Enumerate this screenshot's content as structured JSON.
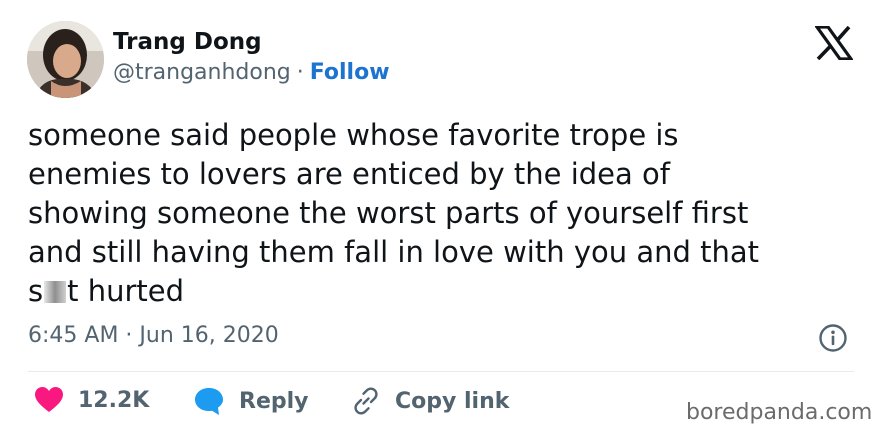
{
  "author": {
    "name": "Trang Dong",
    "handle": "@tranganhdong",
    "separator": "·",
    "follow_label": "Follow"
  },
  "tweet": {
    "text_before": "someone said people whose favorite trope is\nenemies to lovers are enticed by the idea of\nshowing someone the worst parts of yourself first\nand still having them fall in love with you and that\ns",
    "text_after": "t hurted",
    "timestamp": "6:45 AM · Jun 16, 2020"
  },
  "actions": {
    "like_count": "12.2K",
    "reply_label": "Reply",
    "copy_link_label": "Copy link"
  },
  "watermark": "boredpanda.com",
  "icons": {
    "brand": "x-logo-icon",
    "info": "info-icon",
    "like": "heart-icon",
    "reply": "speech-bubble-icon",
    "copy_link": "link-icon"
  },
  "colors": {
    "follow": "#1d73d0",
    "heart": "#f91880",
    "reply_bubble": "#1d9bf0",
    "secondary_text": "#536471"
  }
}
